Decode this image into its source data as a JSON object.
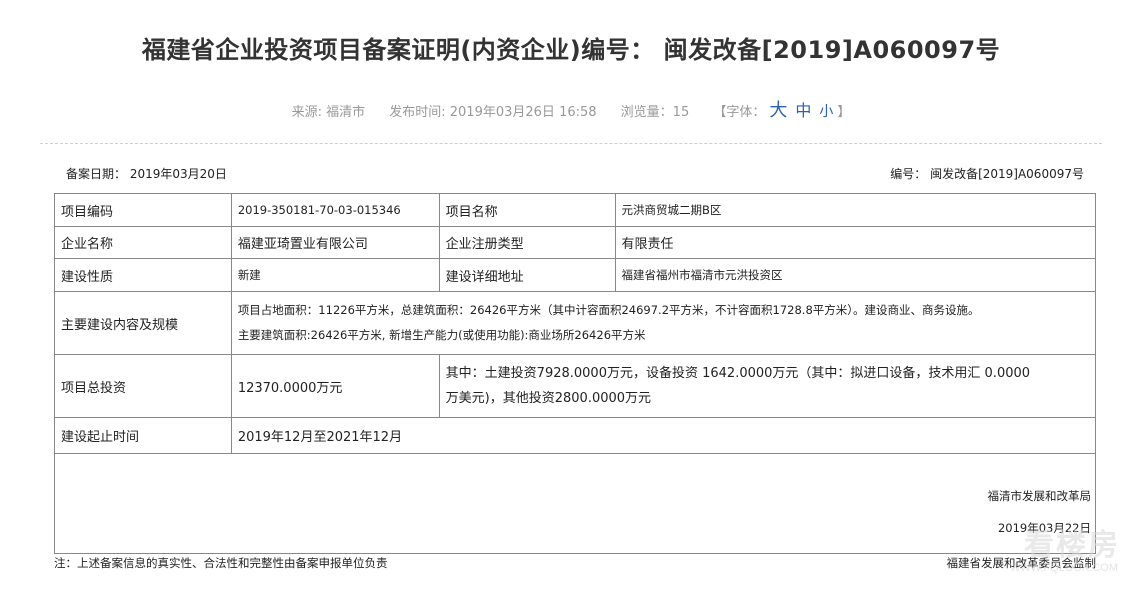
{
  "header": {
    "title": "福建省企业投资项目备案证明(内资企业)编号： 闽发改备[2019]A060097号",
    "source": "来源: 福清市",
    "publish_time": "发布时间: 2019年03月26日 16:58",
    "views": "浏览量：15",
    "font_label_open": "【字体：",
    "font_big": "大",
    "font_mid": "中",
    "font_small": "小",
    "font_label_close": "】"
  },
  "record": {
    "date": "备案日期： 2019年03月20日",
    "number": "编号： 闽发改备[2019]A060097号"
  },
  "table": {
    "project_code_label": "项目编码",
    "project_code": "2019-350181-70-03-015346",
    "project_name_label": "项目名称",
    "project_name": "元洪商贸城二期B区",
    "company_label": "企业名称",
    "company": "福建亚琦置业有限公司",
    "reg_type_label": "企业注册类型",
    "reg_type": "有限责任",
    "nature_label": "建设性质",
    "nature": "新建",
    "address_label": "建设详细地址",
    "address": "福建省福州市福清市元洪投资区",
    "scope_label": "主要建设内容及规模",
    "scope_line1": "项目占地面积：11226平方米，总建筑面积：26426平方米（其中计容面积24697.2平方米，不计容面积1728.8平方米）。建设商业、商务设施。",
    "scope_line2": "主要建筑面积:26426平方米, 新增生产能力(或使用功能):商业场所26426平方米",
    "investment_label": "项目总投资",
    "investment_total": "12370.0000万元",
    "investment_detail_line1": "其中：土建投资7928.0000万元，设备投资 1642.0000万元（其中：拟进口设备，技术用汇 0.0000",
    "investment_detail_line2": "万美元)，其他投资2800.0000万元",
    "period_label": "建设起止时间",
    "period": "2019年12月至2021年12月",
    "sign_org": "福清市发展和改革局",
    "sign_date": "2019年03月22日"
  },
  "footer": {
    "note": "注：上述备案信息的真实性、合法性和完整性由备案申报单位负责",
    "supervisor": "福建省发展和改革委员会监制"
  },
  "watermark": {
    "text": "看楼房",
    "url": "WWW.FQLOOK.COM"
  }
}
